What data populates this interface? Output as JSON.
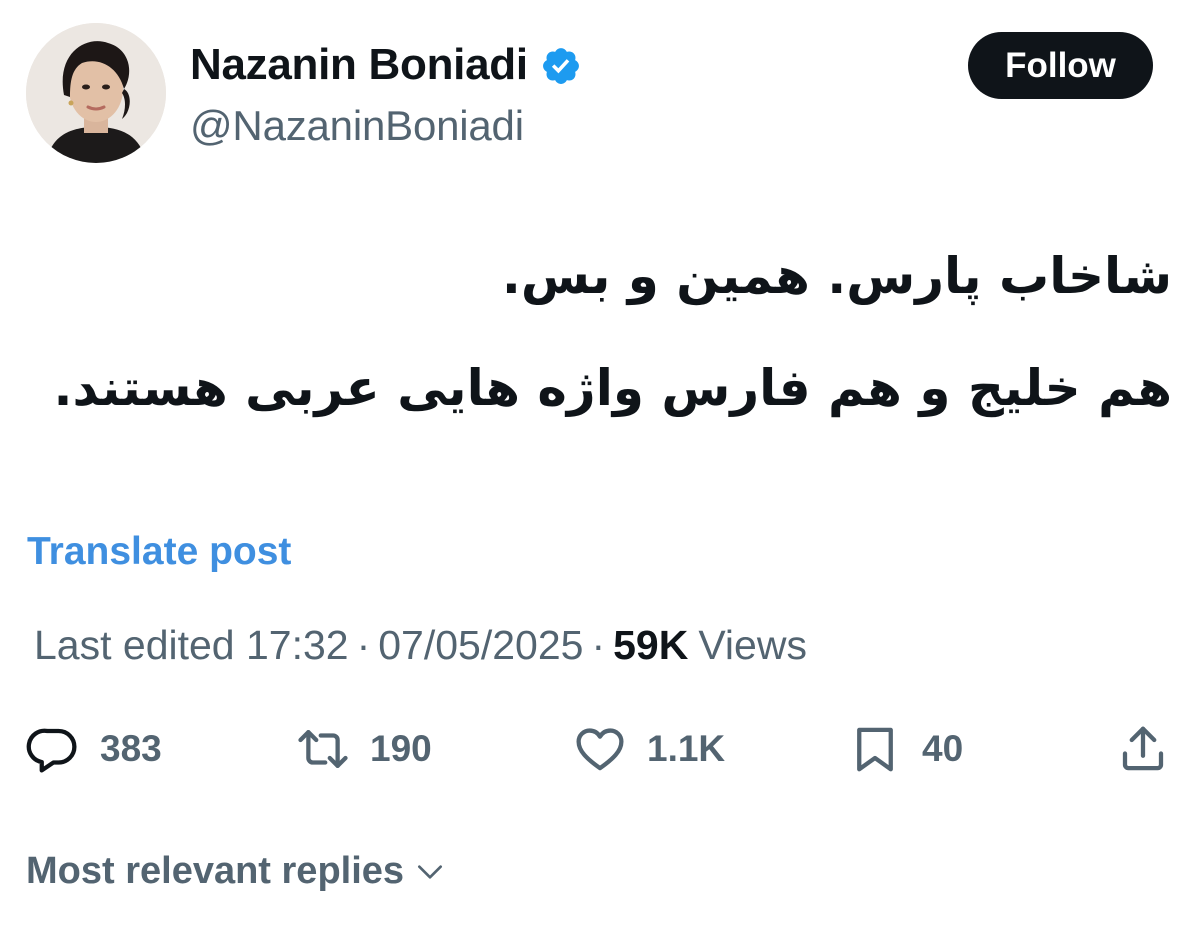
{
  "author": {
    "display_name": "Nazanin Boniadi",
    "handle": "@NazaninBoniadi",
    "verified": true,
    "avatar_icon": "profile-photo"
  },
  "follow_label": "Follow",
  "tweet": {
    "lines": [
      "شاخاب پارس. همین و بس.",
      "هم خلیج و هم فارس واژه هایی عربی هستند."
    ]
  },
  "translate_label": "Translate post",
  "meta": {
    "edited_time": "Last edited 17:32",
    "separator": "·",
    "date": "07/05/2025",
    "views_count": "59K",
    "views_label": "Views"
  },
  "actions": {
    "replies": "383",
    "reposts": "190",
    "likes": "1.1K",
    "bookmarks": "40"
  },
  "replies_sort_label": "Most relevant replies",
  "colors": {
    "text_primary": "#0f1419",
    "text_secondary": "#536471",
    "link": "#3f8fe0",
    "verified": "#1d9bf0",
    "button_bg": "#0f1419"
  }
}
